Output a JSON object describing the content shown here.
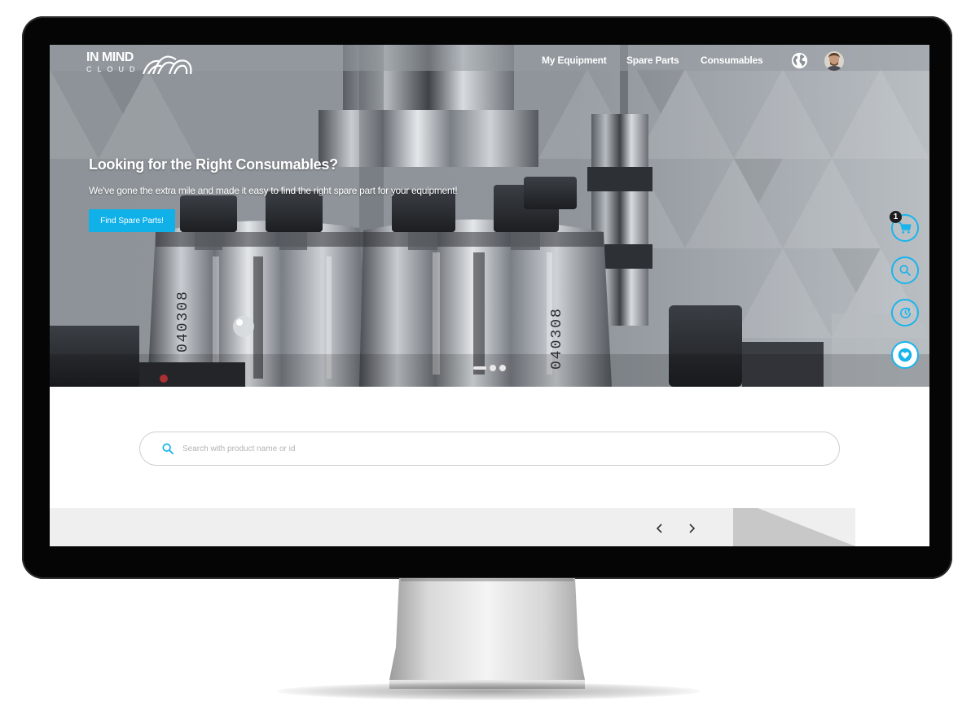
{
  "brand": {
    "line1": "IN MIND",
    "line2": "CLOUD"
  },
  "nav": {
    "items": [
      {
        "label": "My Equipment"
      },
      {
        "label": "Spare Parts"
      },
      {
        "label": "Consumables"
      }
    ]
  },
  "hero": {
    "title": "Looking for the Right Consumables?",
    "subtitle": "We've gone the extra mile and made it easy to find the right spare part for your equipment!",
    "cta_label": "Find Spare Parts!",
    "slides": 3,
    "active_slide": 1,
    "part_markings": [
      "040308",
      "040308"
    ]
  },
  "side_actions": {
    "cart_count": "1",
    "icons": [
      "cart-icon",
      "search-icon",
      "history-icon",
      "heart-icon"
    ]
  },
  "search": {
    "placeholder": "Search with product name or id"
  },
  "carousel": {
    "prev": "‹",
    "next": "›"
  },
  "colors": {
    "accent": "#10b0e8",
    "monitor_bezel": "#050505",
    "strip": "#efefef"
  }
}
